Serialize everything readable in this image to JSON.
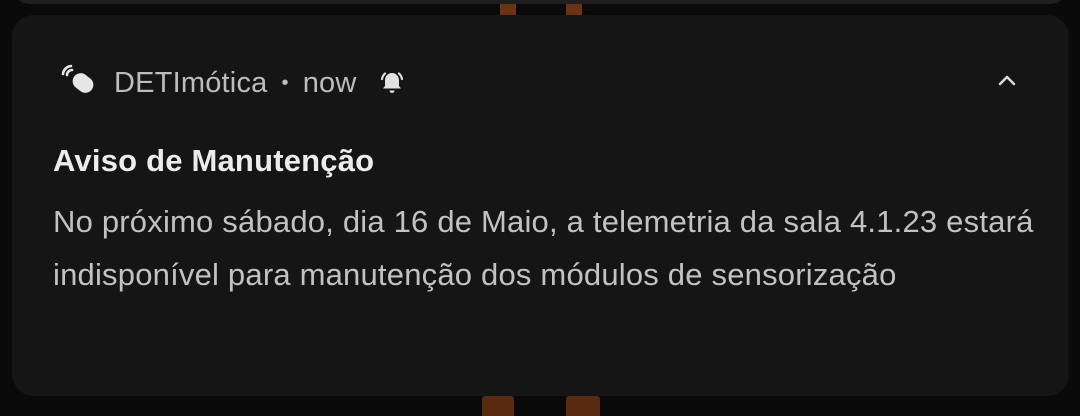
{
  "notification": {
    "app_name": "DETImótica",
    "separator": "•",
    "time": "now",
    "title": "Aviso de Manutenção",
    "body": "No próximo sábado, dia 16 de Maio, a telemetria da sala 4.1.23 estará indisponível para manutenção dos módulos de sensorização",
    "icons": {
      "app": "sensor-tag-icon",
      "alert": "bell-alert-icon",
      "expand": "chevron-up-icon"
    }
  },
  "colors": {
    "card_background": "#151515",
    "title_text": "#ececec",
    "body_text": "#c2c2c2",
    "meta_text": "#bdbdbd"
  }
}
